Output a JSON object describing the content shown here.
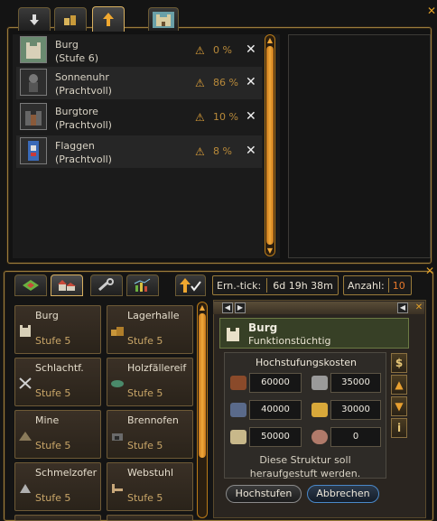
{
  "top": {
    "rows": [
      {
        "name": "Burg",
        "sub": "(Stufe 6)",
        "pct": "0 %",
        "warn": "⚠",
        "del": "✕"
      },
      {
        "name": "Sonnenuhr",
        "sub": "(Prachtvoll)",
        "pct": "86 %",
        "warn": "⚠",
        "del": "✕"
      },
      {
        "name": "Burgtore",
        "sub": "(Prachtvoll)",
        "pct": "10 %",
        "warn": "⚠",
        "del": "✕"
      },
      {
        "name": "Flaggen",
        "sub": "(Prachtvoll)",
        "pct": "8 %",
        "warn": "⚠",
        "del": "✕"
      }
    ],
    "icons": [
      "arrow-down-icon",
      "resources-icon",
      "upgrade-arrow-icon",
      "castle-icon"
    ]
  },
  "bottom": {
    "ern_label": "Ern.-tick:",
    "ern_value": "6d 19h 38m",
    "anzahl_label": "Anzahl:",
    "anzahl_value": "10",
    "buildings": [
      {
        "name": "Burg",
        "level": "Stufe 5"
      },
      {
        "name": "Lagerhalle",
        "level": "Stufe 5"
      },
      {
        "name": "Schlachtf.",
        "level": "Stufe 5"
      },
      {
        "name": "Holzfällereif",
        "level": "Stufe 5"
      },
      {
        "name": "Mine",
        "level": "Stufe 5"
      },
      {
        "name": "Brennofen",
        "level": "Stufe 5"
      },
      {
        "name": "Schmelzofer",
        "level": "Stufe 5"
      },
      {
        "name": "Webstuhl",
        "level": "Stufe 5"
      }
    ],
    "detail": {
      "title": "Burg",
      "status": "Funktionstüchtig",
      "cost_title": "Hochstufungskosten",
      "costs": [
        "60000",
        "35000",
        "40000",
        "30000",
        "50000",
        "0"
      ],
      "message_line1": "Diese Struktur soll",
      "message_line2": "heraufgestuft werden.",
      "upgrade_button": "Hochstufen",
      "cancel_button": "Abbrechen",
      "side_buttons": [
        "$",
        "▲",
        "▼",
        "i"
      ]
    }
  },
  "colors": {
    "accent": "#e8a030",
    "warning": "#e0a23a",
    "panel_green": "#374026"
  }
}
